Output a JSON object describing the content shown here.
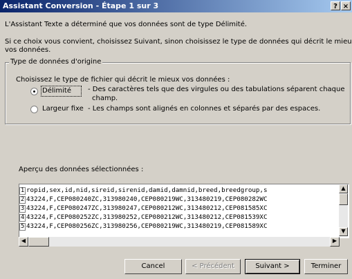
{
  "window": {
    "title": "Assistant Conversion - Étape 1 sur 3",
    "help_label": "?",
    "close_label": "×"
  },
  "intro": {
    "line1": "L'Assistant Texte a déterminé que vos données sont de type Délimité.",
    "line2a": "Si ce choix vous convient, choisissez Suivant, sinon choisissez le type de données qui décrit le mieux",
    "line2b": "vos données."
  },
  "group": {
    "legend": "Type de données d'origine",
    "prompt": "Choisissez le type de fichier qui décrit le mieux vos données :",
    "options": [
      {
        "label": "Délimité",
        "desc1": "- Des caractères tels que des virgules ou des tabulations séparent chaque",
        "desc2": "champ.",
        "selected": true
      },
      {
        "label": "Largeur fixe",
        "desc1": "- Les champs sont alignés en colonnes et séparés par des espaces.",
        "selected": false
      }
    ]
  },
  "preview": {
    "label": "Aperçu des données sélectionnées :",
    "rows": [
      {
        "num": "1",
        "text": "ropid,sex,id,nid,sireid,sirenid,damid,damnid,breed,breedgroup,s"
      },
      {
        "num": "2",
        "text": "43224,F,CEP080240ZC,313980240,CEP080219WC,313480219,CEP080282WC"
      },
      {
        "num": "3",
        "text": "43224,F,CEP080247ZC,313980247,CEP080212WC,313480212,CEP081585XC"
      },
      {
        "num": "4",
        "text": "43224,F,CEP080252ZC,313980252,CEP080212WC,313480212,CEP081539XC"
      },
      {
        "num": "5",
        "text": "43224,F,CEP080256ZC,313980256,CEP080219WC,313480219,CEP081589XC"
      }
    ]
  },
  "buttons": {
    "cancel": "Cancel",
    "previous": "< Précédent",
    "next": "Suivant >",
    "finish": "Terminer"
  }
}
